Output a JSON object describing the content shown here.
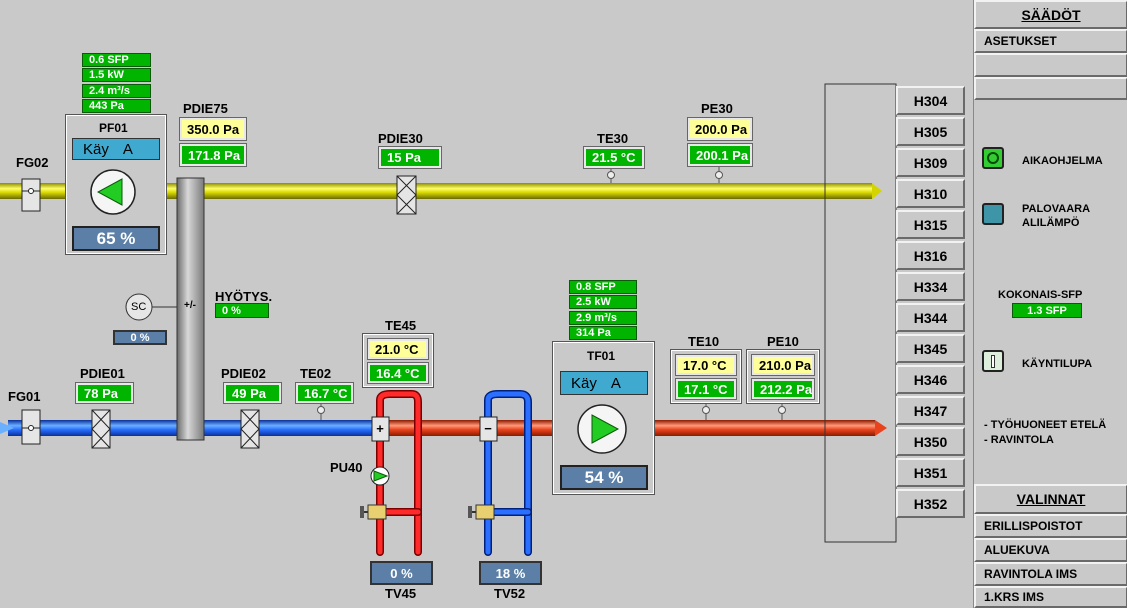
{
  "fans": {
    "pf01": {
      "name": "PF01",
      "status": "Käy",
      "mode": "A",
      "percent": "65 %",
      "stats": [
        "0.6 SFP",
        "1.5 kW",
        "2.4 m³/s",
        "443 Pa"
      ]
    },
    "tf01": {
      "name": "TF01",
      "status": "Käy",
      "mode": "A",
      "percent": "54 %",
      "stats": [
        "0.8 SFP",
        "2.5 kW",
        "2.9 m³/s",
        "314 Pa"
      ]
    }
  },
  "dampers": {
    "fg02": "FG02",
    "fg01": "FG01"
  },
  "sensors": {
    "pdie75": {
      "name": "PDIE75",
      "setpoint": "350.0 Pa",
      "value": "171.8 Pa"
    },
    "pdie30": {
      "name": "PDIE30",
      "value": "15 Pa"
    },
    "te30": {
      "name": "TE30",
      "value": "21.5 °C"
    },
    "pe30": {
      "name": "PE30",
      "setpoint": "200.0 Pa",
      "value": "200.1 Pa"
    },
    "pdie01": {
      "name": "PDIE01",
      "value": "78 Pa"
    },
    "pdie02": {
      "name": "PDIE02",
      "value": "49 Pa"
    },
    "te02": {
      "name": "TE02",
      "value": "16.7 °C"
    },
    "te45": {
      "name": "TE45",
      "setpoint": "21.0 °C",
      "value": "16.4 °C"
    },
    "te10": {
      "name": "TE10",
      "setpoint": "17.0 °C",
      "value": "17.1 °C"
    },
    "pe10": {
      "name": "PE10",
      "setpoint": "210.0 Pa",
      "value": "212.2 Pa"
    }
  },
  "heat_recovery": {
    "label": "HYÖTYS.",
    "value": "0 %",
    "sc_label": "SC",
    "sc_value": "0 %",
    "exchanger_label": "+/-"
  },
  "pump": {
    "name": "PU40"
  },
  "valves": {
    "tv45": {
      "name": "TV45",
      "value": "0 %"
    },
    "tv52": {
      "name": "TV52",
      "value": "18 %"
    }
  },
  "rooms": [
    "H304",
    "H305",
    "H309",
    "H310",
    "H315",
    "H316",
    "H334",
    "H344",
    "H345",
    "H346",
    "H347",
    "H350",
    "H351",
    "H352"
  ],
  "sidebar": {
    "header": "SÄÄDÖT",
    "asetukset": "ASETUKSET",
    "aikaohjelma": "AIKAOHJELMA",
    "palovaara_line1": "PALOVAARA",
    "palovaara_line2": "ALILÄMPÖ",
    "kokonais_label": "KOKONAIS-SFP",
    "kokonais_value": "1.3 SFP",
    "kayntilupa": "KÄYNTILUPA",
    "zones_line1": "- TYÖHUONEET ETELÄ",
    "zones_line2": "- RAVINTOLA",
    "valinnat": "VALINNAT",
    "links": [
      "ERILLISPOISTOT",
      "ALUEKUVA",
      "RAVINTOLA IMS",
      "1.KRS IMS"
    ]
  },
  "colors": {
    "background": "#c9c9c9",
    "value_green": "#00b400",
    "setpoint_yellow": "#ffff99",
    "exhaust_duct": "#d4d400",
    "supply_cold": "#2a6fff",
    "supply_warm": "#e8431c",
    "status_blue": "#3fa9d0",
    "percent_box": "#5b7fa6"
  }
}
